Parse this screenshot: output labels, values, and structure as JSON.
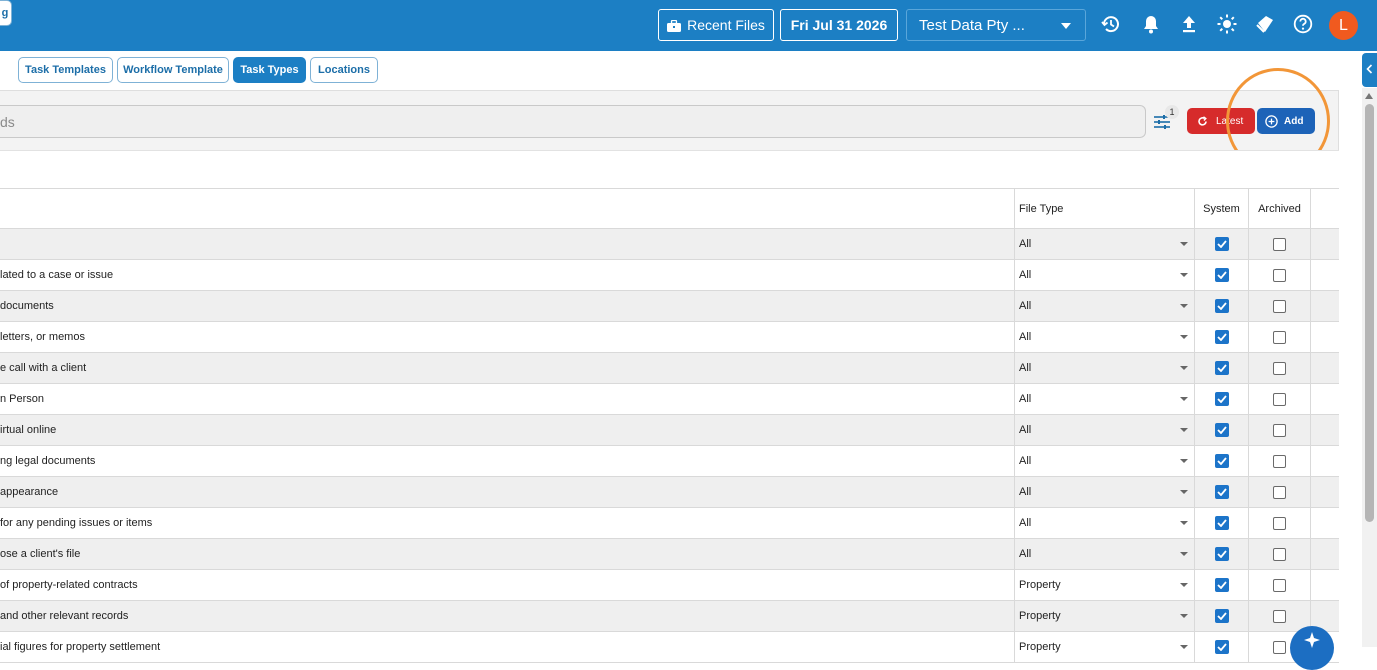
{
  "header": {
    "recent_files_label": "Recent Files",
    "date_label": "Fri Jul 31 2026",
    "company_label": "Test Data Pty ...",
    "avatar_initial": "L",
    "icons": [
      "history-icon",
      "bell-icon",
      "upload-icon",
      "sun-icon",
      "tag-icon",
      "help-icon"
    ]
  },
  "tabs": [
    {
      "label": "g",
      "active": false
    },
    {
      "label": "Task Templates",
      "active": false
    },
    {
      "label": "Workflow Template",
      "active": false
    },
    {
      "label": "Task Types",
      "active": true
    },
    {
      "label": "Locations",
      "active": false
    }
  ],
  "toolbar": {
    "search_placeholder": "ds",
    "filter_badge": "1",
    "latest_label": "Latest",
    "add_label": "Add"
  },
  "table": {
    "columns": {
      "file_type": "File Type",
      "system": "System",
      "archived": "Archived"
    },
    "rows": [
      {
        "description": "",
        "file_type": "All",
        "system": true,
        "archived": false
      },
      {
        "description": "lated to a case or issue",
        "file_type": "All",
        "system": true,
        "archived": false
      },
      {
        "description": "documents",
        "file_type": "All",
        "system": true,
        "archived": false
      },
      {
        "description": "letters, or memos",
        "file_type": "All",
        "system": true,
        "archived": false
      },
      {
        "description": "e call with a client",
        "file_type": "All",
        "system": true,
        "archived": false
      },
      {
        "description": "n Person",
        "file_type": "All",
        "system": true,
        "archived": false
      },
      {
        "description": "irtual online",
        "file_type": "All",
        "system": true,
        "archived": false
      },
      {
        "description": "ng legal documents",
        "file_type": "All",
        "system": true,
        "archived": false
      },
      {
        "description": " appearance",
        "file_type": "All",
        "system": true,
        "archived": false
      },
      {
        "description": "for any pending issues or items",
        "file_type": "All",
        "system": true,
        "archived": false
      },
      {
        "description": "ose a client's file",
        "file_type": "All",
        "system": true,
        "archived": false
      },
      {
        "description": "of property-related contracts",
        "file_type": "Property",
        "system": true,
        "archived": false
      },
      {
        "description": "and other relevant records",
        "file_type": "Property",
        "system": true,
        "archived": false
      },
      {
        "description": "ial figures for property settlement",
        "file_type": "Property",
        "system": true,
        "archived": false
      }
    ]
  },
  "colors": {
    "topbar": "#1c7fc4",
    "active_tab": "#1c7fc4",
    "latest_button": "#d62b2b",
    "add_button": "#1d63b8",
    "checkbox_checked": "#1c74c9",
    "avatar": "#f05a1f",
    "highlight_ring": "#f29638"
  }
}
